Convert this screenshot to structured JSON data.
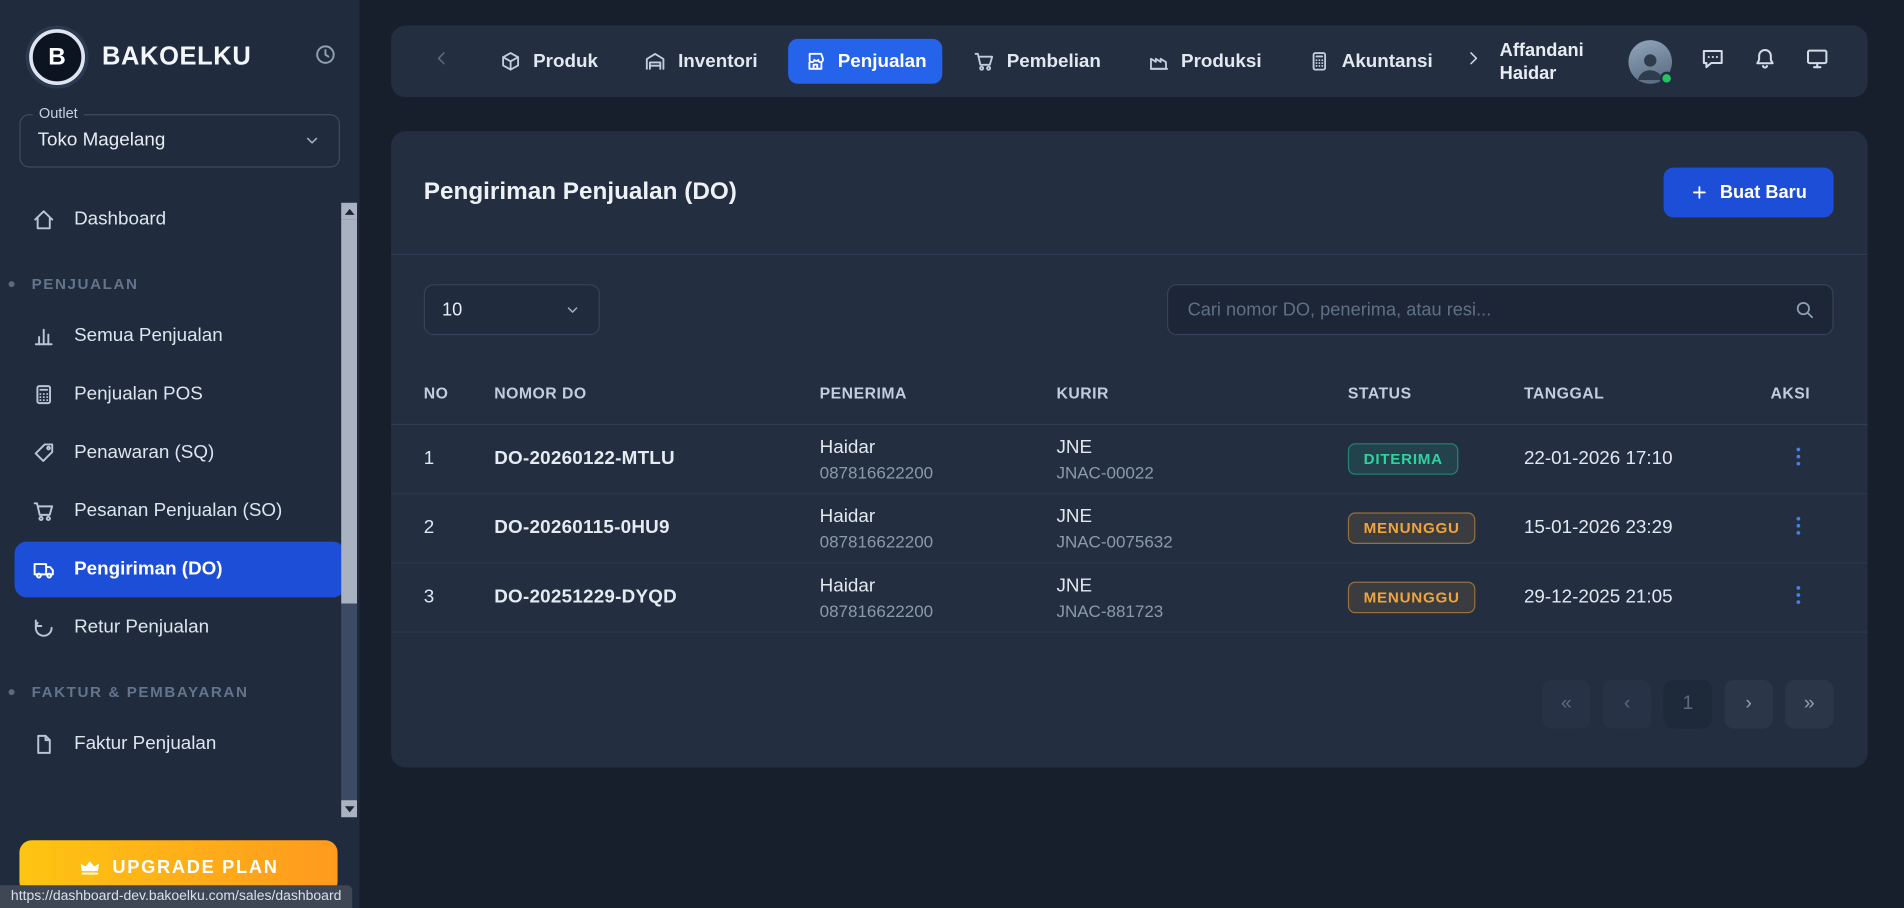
{
  "app": {
    "name": "BAKOELKU",
    "logo_letter": "B"
  },
  "sidebar": {
    "outlet_label": "Outlet",
    "outlet_value": "Toko Magelang",
    "items": [
      {
        "label": "Dashboard",
        "type": "item"
      },
      {
        "label": "PENJUALAN",
        "type": "section"
      },
      {
        "label": "Semua Penjualan",
        "type": "item"
      },
      {
        "label": "Penjualan POS",
        "type": "item"
      },
      {
        "label": "Penawaran (SQ)",
        "type": "item"
      },
      {
        "label": "Pesanan Penjualan (SO)",
        "type": "item"
      },
      {
        "label": "Pengiriman (DO)",
        "type": "item",
        "active": true
      },
      {
        "label": "Retur Penjualan",
        "type": "item"
      },
      {
        "label": "FAKTUR & PEMBAYARAN",
        "type": "section"
      },
      {
        "label": "Faktur Penjualan",
        "type": "item"
      }
    ],
    "upgrade_label": "UPGRADE PLAN"
  },
  "topbar": {
    "items": [
      {
        "label": "Produk"
      },
      {
        "label": "Inventori"
      },
      {
        "label": "Penjualan",
        "active": true
      },
      {
        "label": "Pembelian"
      },
      {
        "label": "Produksi"
      },
      {
        "label": "Akuntansi"
      }
    ],
    "user_name": "Affandani Haidar"
  },
  "main": {
    "title": "Pengiriman Penjualan (DO)",
    "create_button_label": "Buat Baru",
    "page_size": "10",
    "search_placeholder": "Cari nomor DO, penerima, atau resi...",
    "table": {
      "headers": [
        "NO",
        "NOMOR DO",
        "PENERIMA",
        "KURIR",
        "STATUS",
        "TANGGAL",
        "AKSI"
      ],
      "rows": [
        {
          "no": "1",
          "nomor_do": "DO-20260122-MTLU",
          "penerima_nama": "Haidar",
          "penerima_telepon": "087816622200",
          "kurir": "JNE",
          "resi": "JNAC-00022",
          "status": "DITERIMA",
          "tanggal": "22-01-2026 17:10"
        },
        {
          "no": "2",
          "nomor_do": "DO-20260115-0HU9",
          "penerima_nama": "Haidar",
          "penerima_telepon": "087816622200",
          "kurir": "JNE",
          "resi": "JNAC-0075632",
          "status": "MENUNGGU",
          "tanggal": "15-01-2026 23:29"
        },
        {
          "no": "3",
          "nomor_do": "DO-20251229-DYQD",
          "penerima_nama": "Haidar",
          "penerima_telepon": "087816622200",
          "kurir": "JNE",
          "resi": "JNAC-881723",
          "status": "MENUNGGU",
          "tanggal": "29-12-2025 21:05"
        }
      ]
    },
    "pagination": {
      "first": "«",
      "prev": "‹",
      "current_page": "1",
      "next": "›",
      "last": "»"
    }
  },
  "statusbar": {
    "url": "https://dashboard-dev.bakoelku.com/sales/dashboard"
  },
  "colors": {
    "accent_blue": "#2563eb",
    "active_nav_blue": "#1d4ed8",
    "status_success": "#2dd4a0",
    "status_warning": "#f0a43c",
    "upgrade_gradient_start": "#fdc511",
    "upgrade_gradient_end": "#ff9a1f"
  }
}
